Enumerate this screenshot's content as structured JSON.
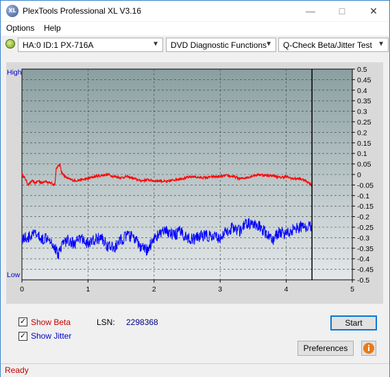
{
  "window": {
    "title": "PlexTools Professional XL V3.16"
  },
  "titlebar": {
    "minimize_icon": "minimize-icon",
    "maximize_icon": "maximize-icon",
    "close_icon": "close-icon"
  },
  "menu": {
    "items": [
      {
        "label": "Options"
      },
      {
        "label": "Help"
      }
    ]
  },
  "toolbar": {
    "drive": "HA:0 ID:1  PX-716A",
    "function": "DVD Diagnostic Functions",
    "test": "Q-Check Beta/Jitter Test"
  },
  "chart": {
    "left_top_label": "High",
    "left_bottom_label": "Low",
    "colors": {
      "background_top": "#8a9fa1",
      "background_bottom": "#e4e8ea",
      "beta": "#ff0000",
      "jitter": "#0000ff",
      "left_label": "#0000cc"
    }
  },
  "chart_data": {
    "type": "line",
    "x_ticks": [
      "0",
      "1",
      "2",
      "3",
      "4",
      "5"
    ],
    "xlim": [
      0,
      5
    ],
    "y_ticks": [
      "0.5",
      "0.45",
      "0.4",
      "0.35",
      "0.3",
      "0.25",
      "0.2",
      "0.15",
      "0.1",
      "0.05",
      "0",
      "-0.05",
      "-0.1",
      "-0.15",
      "-0.2",
      "-0.25",
      "-0.3",
      "-0.35",
      "-0.4",
      "-0.45",
      "-0.5"
    ],
    "ylim": [
      -0.5,
      0.5
    ],
    "grid": true,
    "marker_x": 4.39,
    "series": [
      {
        "key": "beta",
        "x": [
          0,
          0.05,
          0.1,
          0.15,
          0.2,
          0.25,
          0.3,
          0.35,
          0.4,
          0.45,
          0.48,
          0.5,
          0.52,
          0.55,
          0.58,
          0.6,
          0.65,
          0.7,
          0.8,
          0.9,
          1.0,
          1.1,
          1.2,
          1.3,
          1.4,
          1.5,
          1.6,
          1.7,
          1.8,
          1.9,
          2.0,
          2.1,
          2.2,
          2.3,
          2.4,
          2.5,
          2.6,
          2.7,
          2.8,
          2.9,
          3.0,
          3.1,
          3.2,
          3.3,
          3.4,
          3.5,
          3.6,
          3.7,
          3.8,
          3.9,
          4.0,
          4.1,
          4.2,
          4.3,
          4.39
        ],
        "y": [
          0,
          -0.02,
          -0.05,
          -0.03,
          -0.04,
          -0.03,
          -0.04,
          -0.03,
          -0.04,
          -0.04,
          -0.05,
          -0.04,
          0.03,
          0.04,
          0.045,
          0.01,
          -0.01,
          -0.02,
          -0.03,
          -0.025,
          -0.02,
          -0.01,
          -0.005,
          0,
          -0.01,
          -0.015,
          -0.01,
          -0.02,
          -0.03,
          -0.025,
          -0.03,
          -0.03,
          -0.035,
          -0.025,
          -0.02,
          -0.015,
          -0.01,
          -0.015,
          -0.015,
          -0.01,
          -0.01,
          -0.005,
          -0.01,
          -0.02,
          -0.015,
          -0.005,
          0,
          -0.005,
          -0.005,
          -0.015,
          -0.01,
          -0.02,
          -0.02,
          -0.03,
          -0.05
        ]
      },
      {
        "key": "jitter",
        "x": [
          0,
          0.1,
          0.2,
          0.3,
          0.4,
          0.45,
          0.5,
          0.55,
          0.6,
          0.7,
          0.8,
          0.9,
          1.0,
          1.1,
          1.2,
          1.3,
          1.4,
          1.5,
          1.6,
          1.7,
          1.8,
          1.9,
          2.0,
          2.1,
          2.2,
          2.3,
          2.4,
          2.5,
          2.6,
          2.7,
          2.8,
          2.9,
          3.0,
          3.1,
          3.2,
          3.3,
          3.4,
          3.5,
          3.6,
          3.7,
          3.8,
          3.9,
          4.0,
          4.1,
          4.2,
          4.3,
          4.39
        ],
        "y": [
          -0.3,
          -0.3,
          -0.28,
          -0.31,
          -0.29,
          -0.32,
          -0.35,
          -0.38,
          -0.33,
          -0.31,
          -0.33,
          -0.3,
          -0.33,
          -0.31,
          -0.3,
          -0.34,
          -0.35,
          -0.31,
          -0.29,
          -0.3,
          -0.35,
          -0.36,
          -0.3,
          -0.28,
          -0.27,
          -0.29,
          -0.27,
          -0.3,
          -0.31,
          -0.29,
          -0.29,
          -0.3,
          -0.3,
          -0.27,
          -0.25,
          -0.27,
          -0.23,
          -0.24,
          -0.25,
          -0.28,
          -0.31,
          -0.27,
          -0.28,
          -0.26,
          -0.25,
          -0.25,
          -0.24
        ]
      }
    ]
  },
  "controls": {
    "show_beta_label": "Show Beta",
    "show_beta_checked": true,
    "show_jitter_label": "Show Jitter",
    "show_jitter_checked": true,
    "lsn_label": "LSN:",
    "lsn_value": "2298368",
    "start_label": "Start",
    "preferences_label": "Preferences",
    "info_icon": "info-icon"
  },
  "status": {
    "text": "Ready"
  }
}
